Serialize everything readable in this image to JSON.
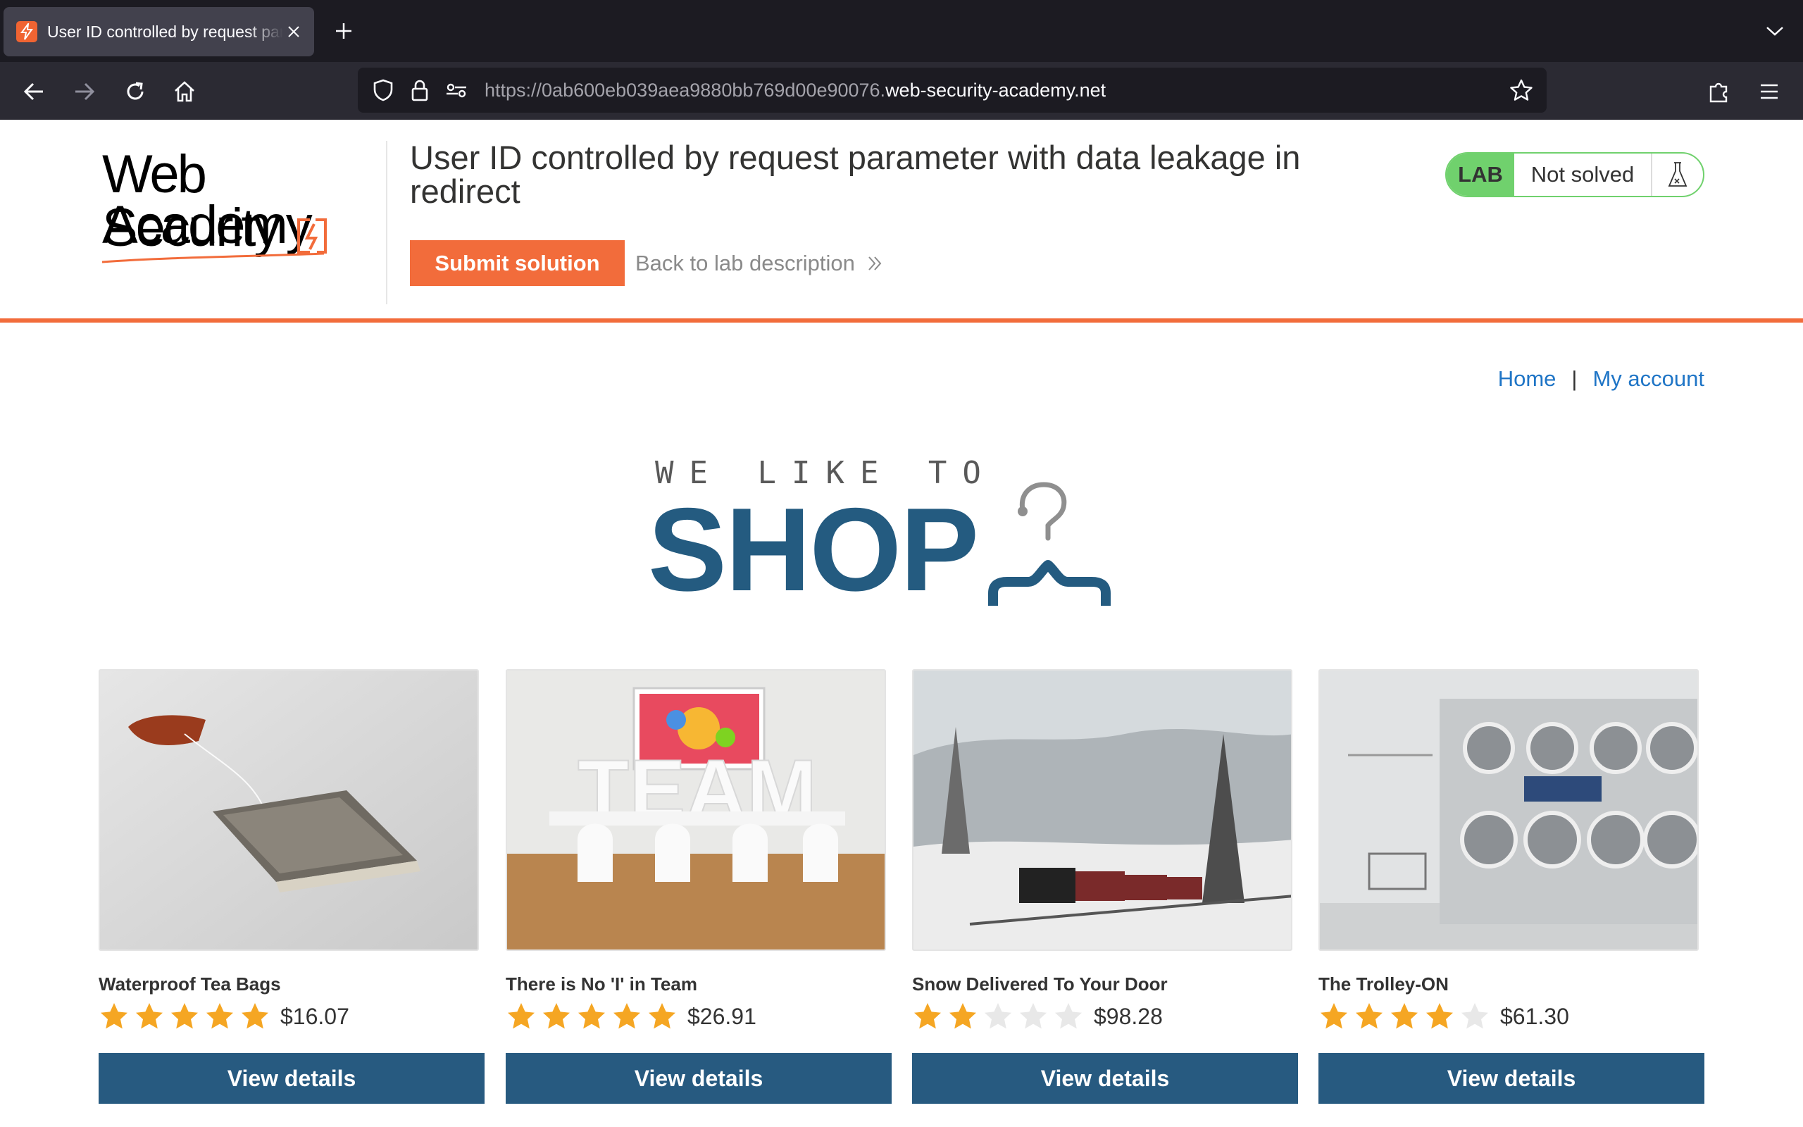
{
  "browser": {
    "tab_title": "User ID controlled by request parameter with data leakage in redirect",
    "url_prefix": "https://0ab600eb039aea9880bb769d00e90076.",
    "url_host": "web-security-academy.net"
  },
  "academy": {
    "logo_line1": "Web Security",
    "logo_line2": "Academy",
    "lab_title": "User ID controlled by request parameter with data leakage in redirect",
    "submit_label": "Submit solution",
    "back_label": "Back to lab description",
    "lab_badge": "LAB",
    "lab_status": "Not solved"
  },
  "nav": {
    "home": "Home",
    "separator": "|",
    "account": "My account"
  },
  "banner": {
    "top": "WE LIKE TO",
    "main": "SHOP"
  },
  "colors": {
    "accent": "#f26c3b",
    "primary_button": "#275a80",
    "link": "#1f75c6",
    "lab_green": "#70d16d",
    "star": "#f5a623"
  },
  "products": [
    {
      "name": "Waterproof Tea Bags",
      "rating": 5,
      "price": "$16.07",
      "button": "View details"
    },
    {
      "name": "There is No 'I' in Team",
      "rating": 5,
      "price": "$26.91",
      "button": "View details"
    },
    {
      "name": "Snow Delivered To Your Door",
      "rating": 2,
      "price": "$98.28",
      "button": "View details"
    },
    {
      "name": "The Trolley-ON",
      "rating": 4,
      "price": "$61.30",
      "button": "View details"
    }
  ]
}
